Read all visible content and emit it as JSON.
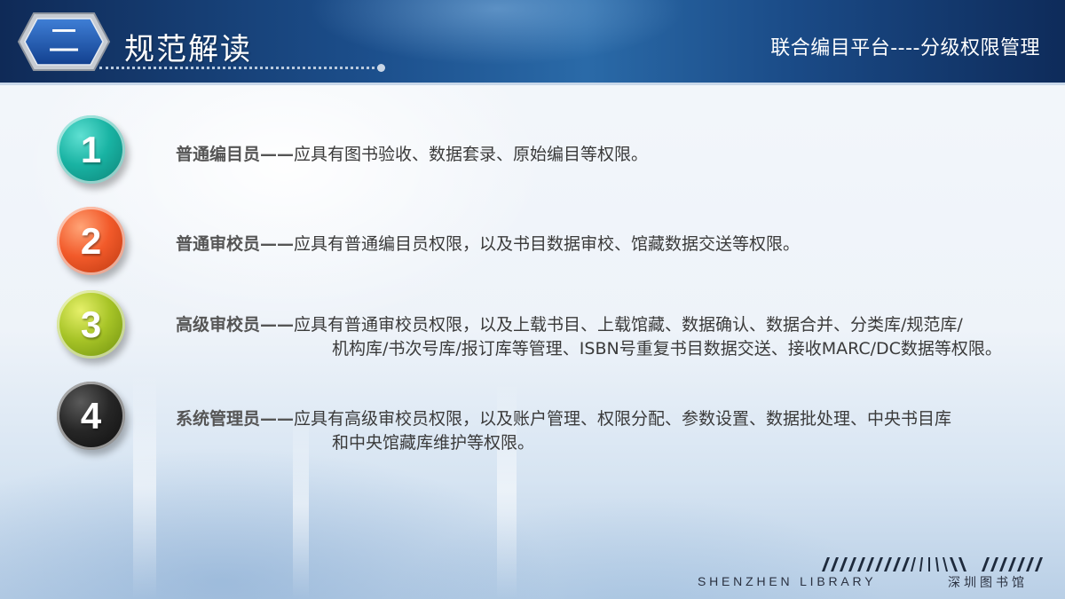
{
  "header": {
    "section_number": "二",
    "section_title": "规范解读",
    "platform_title": "联合编目平台----分级权限管理"
  },
  "items": [
    {
      "number": "1",
      "color": "#19b3a3",
      "role": "普通编目员",
      "dash": "——",
      "line1": "应具有图书验收、数据套录、原始编目等权限。",
      "line2": ""
    },
    {
      "number": "2",
      "color": "#f25a2a",
      "role": "普通审校员",
      "dash": "——",
      "line1": "应具有普通编目员权限，以及书目数据审校、馆藏数据交送等权限。",
      "line2": ""
    },
    {
      "number": "3",
      "color": "#a7c427",
      "role": "高级审校员",
      "dash": "——",
      "line1": "应具有普通审校员权限，以及上载书目、上载馆藏、数据确认、数据合并、分类库/规范库/",
      "line2": "机构库/书次号库/报订库等管理、ISBN号重复书目数据交送、接收MARC/DC数据等权限。"
    },
    {
      "number": "4",
      "color": "#262626",
      "role": "系统管理员",
      "dash": "——",
      "line1": "应具有高级审校员权限，以及账户管理、权限分配、参数设置、数据批处理、中央书目库",
      "line2": "和中央馆藏库维护等权限。"
    }
  ],
  "footer": {
    "logo_en": "SHENZHEN LIBRARY",
    "logo_cn": "深圳图书馆"
  }
}
